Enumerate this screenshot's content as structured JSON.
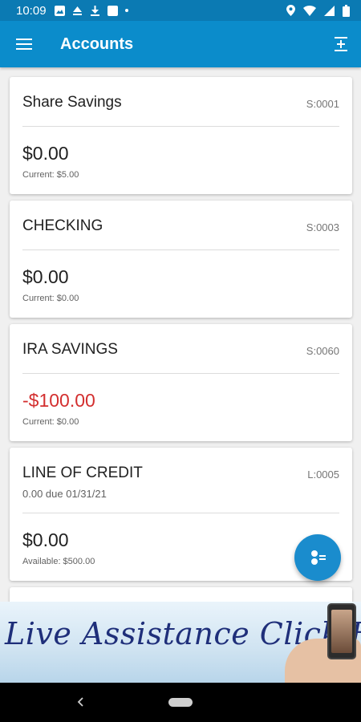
{
  "status_bar": {
    "time": "10:09"
  },
  "header": {
    "title": "Accounts"
  },
  "accounts": [
    {
      "name": "Share Savings",
      "number": "S:0001",
      "subtitle": "",
      "balance": "$0.00",
      "detail": "Current: $5.00",
      "negative": false
    },
    {
      "name": "CHECKING",
      "number": "S:0003",
      "subtitle": "",
      "balance": "$0.00",
      "detail": "Current: $0.00",
      "negative": false
    },
    {
      "name": "IRA SAVINGS",
      "number": "S:0060",
      "subtitle": "",
      "balance": "-$100.00",
      "detail": "Current: $0.00",
      "negative": true
    },
    {
      "name": "LINE OF CREDIT",
      "number": "L:0005",
      "subtitle": "0.00 due 01/31/21",
      "balance": "$0.00",
      "detail": "Available: $500.00",
      "negative": false
    }
  ],
  "banner": {
    "text": "Live Assistance Click Here!"
  },
  "colors": {
    "status_bar": "#0b7ab3",
    "app_bar": "#0b8ccb",
    "negative": "#d32f2f",
    "fab": "#1a8ccd"
  },
  "icons": {
    "menu": "hamburger-menu-icon",
    "transfer": "transfer-icon",
    "fab": "quick-balance-icon",
    "back": "back-icon",
    "home": "home-icon"
  }
}
